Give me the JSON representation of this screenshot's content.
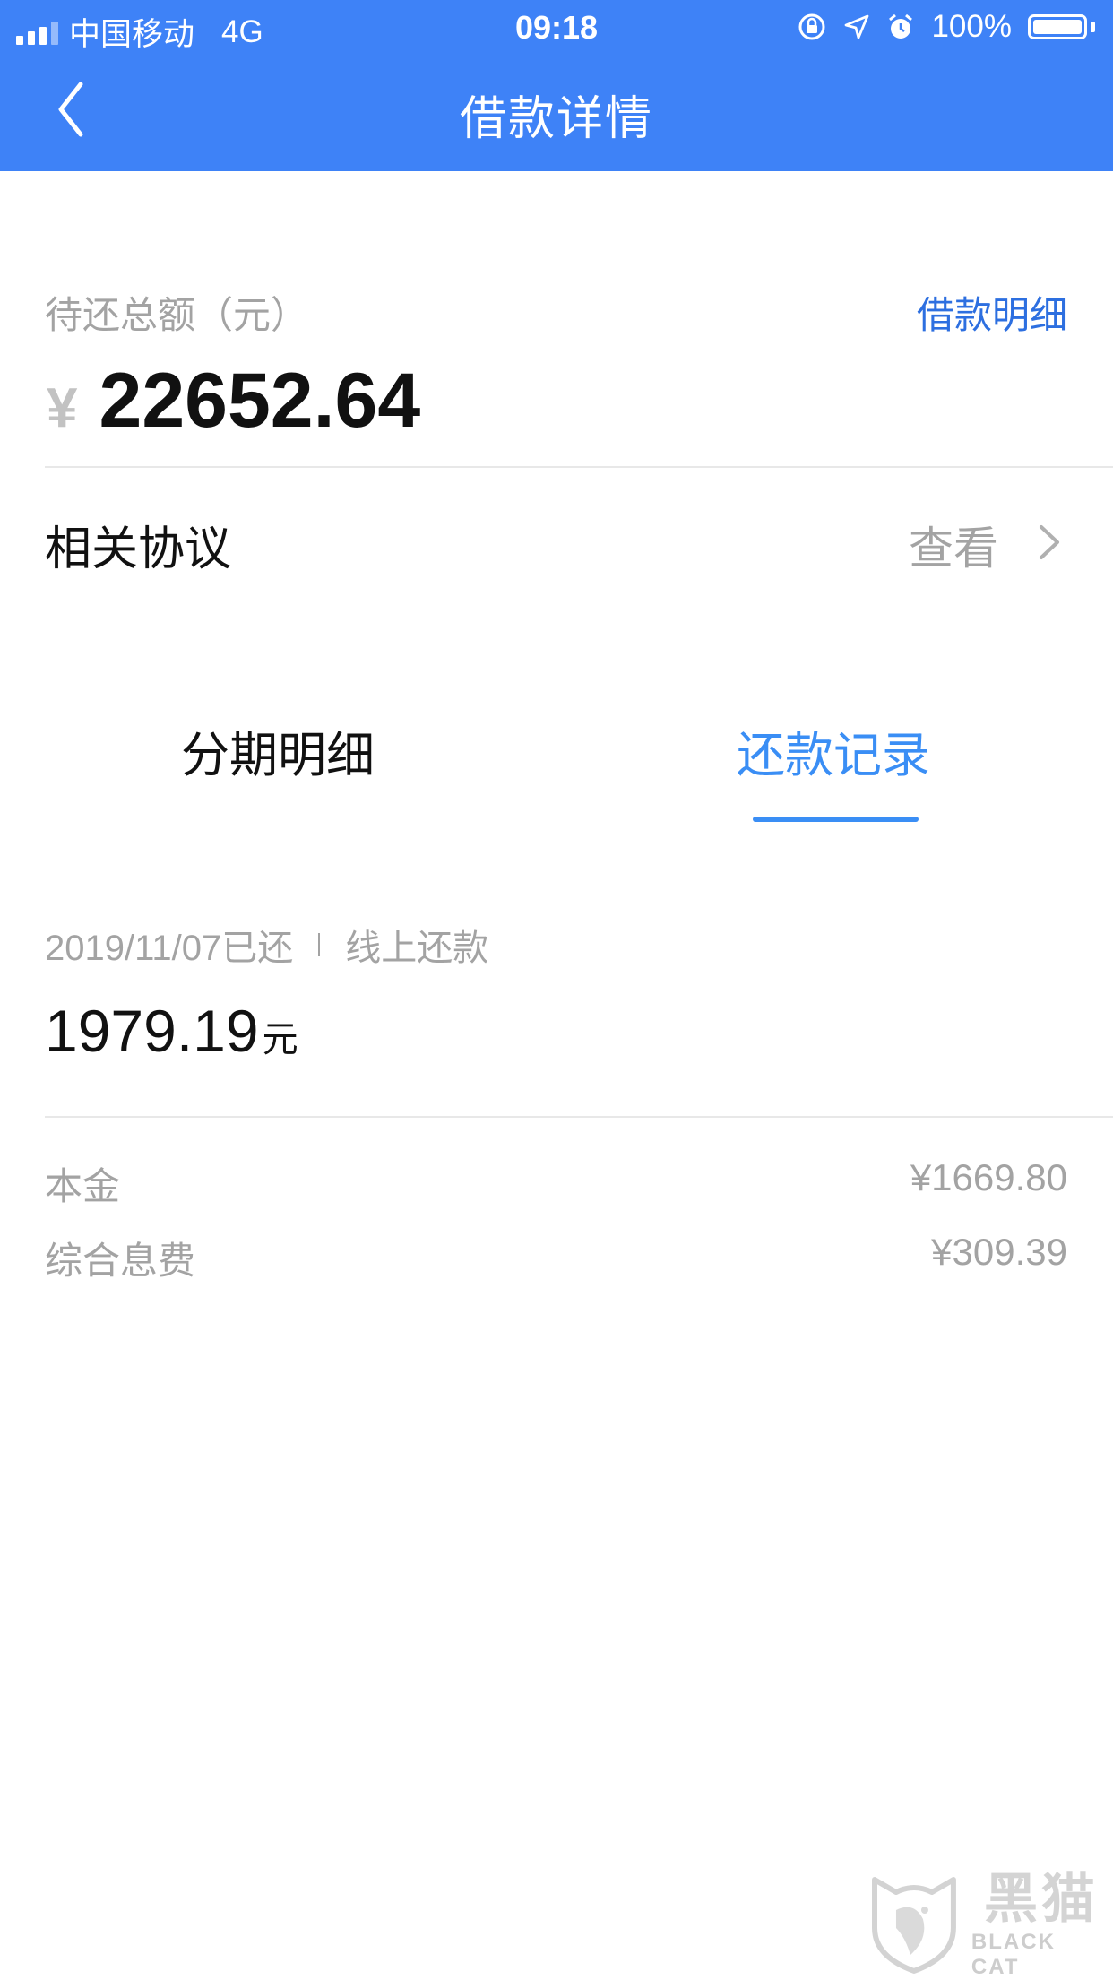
{
  "status_bar": {
    "carrier": "中国移动",
    "network": "4G",
    "time": "09:18",
    "battery": "100%"
  },
  "nav": {
    "title": "借款详情"
  },
  "summary": {
    "total_label": "待还总额（元）",
    "detail_link": "借款明细",
    "currency_symbol": "¥",
    "total_amount": "22652.64"
  },
  "agreement": {
    "label": "相关协议",
    "view_label": "查看"
  },
  "tabs": [
    {
      "label": "分期明细",
      "active": false
    },
    {
      "label": "还款记录",
      "active": true
    }
  ],
  "record": {
    "date_status": "2019/11/07已还",
    "method": "线上还款",
    "amount": "1979.19",
    "unit": "元",
    "breakdown": [
      {
        "label": "本金",
        "value": "¥1669.80"
      },
      {
        "label": "综合息费",
        "value": "¥309.39"
      }
    ]
  },
  "watermark": {
    "cn": "黑猫",
    "en": "BLACK CAT"
  },
  "colors": {
    "brand": "#3e82f7",
    "active_tab": "#3a8ef5",
    "link": "#2d6fe0"
  }
}
